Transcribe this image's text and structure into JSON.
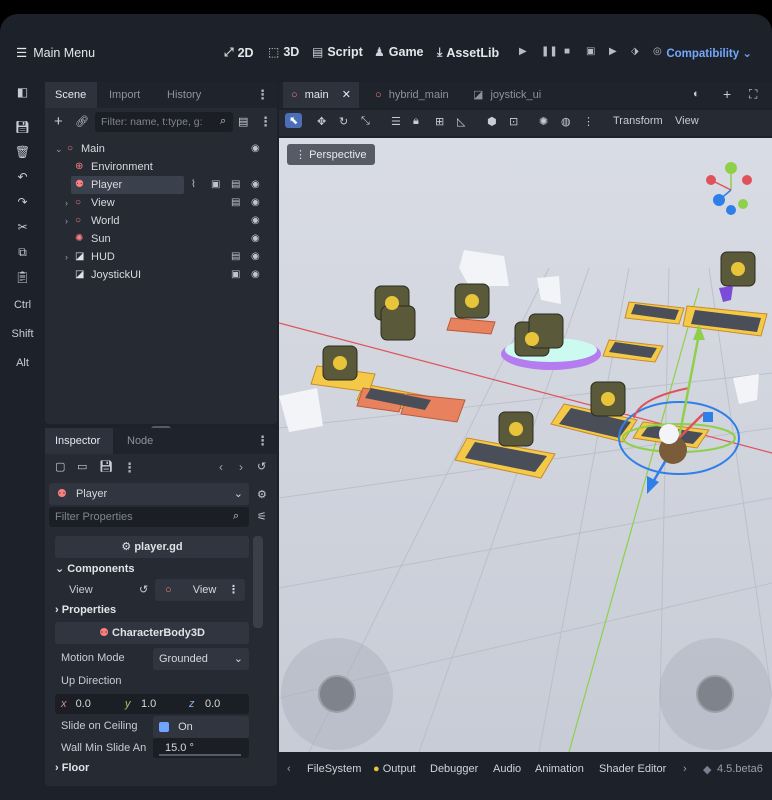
{
  "topbar": {
    "main_menu": "Main Menu",
    "workspaces": [
      "2D",
      "3D",
      "Script",
      "Game",
      "AssetLib"
    ],
    "renderer": "Compatibility"
  },
  "left_toolbar": {
    "ctrl": "Ctrl",
    "shift": "Shift",
    "alt": "Alt"
  },
  "scene_dock": {
    "tabs": [
      "Scene",
      "Import",
      "History"
    ],
    "filter_placeholder": "Filter: name, t:type, g:",
    "nodes": [
      {
        "label": "Main"
      },
      {
        "label": "Environment"
      },
      {
        "label": "Player"
      },
      {
        "label": "View"
      },
      {
        "label": "World"
      },
      {
        "label": "Sun"
      },
      {
        "label": "HUD"
      },
      {
        "label": "JoystickUI"
      }
    ]
  },
  "inspector": {
    "tabs": [
      "Inspector",
      "Node"
    ],
    "object": "Player",
    "filter_placeholder": "Filter Properties",
    "script": "player.gd",
    "components_label": "Components",
    "view_label": "View",
    "view_value": "View",
    "properties_label": "Properties",
    "class_section": "CharacterBody3D",
    "motion_mode_label": "Motion Mode",
    "motion_mode_value": "Grounded",
    "up_direction_label": "Up Direction",
    "up_x_label": "x",
    "up_x": "0.0",
    "up_y_label": "y",
    "up_y": "1.0",
    "up_z_label": "z",
    "up_z": "0.0",
    "slide_on_ceiling_label": "Slide on Ceiling",
    "slide_on_ceiling_value": "On",
    "wall_min_slide_label": "Wall Min Slide An",
    "wall_min_slide_value": "15.0 °",
    "floor_label": "Floor"
  },
  "editor": {
    "tabs": [
      "main",
      "hybrid_main",
      "joystick_ui"
    ],
    "transform": "Transform",
    "view": "View",
    "perspective": "Perspective"
  },
  "bottom": {
    "panels": [
      "FileSystem",
      "Output",
      "Debugger",
      "Audio",
      "Animation",
      "Shader Editor"
    ],
    "version": "4.5.beta6"
  }
}
